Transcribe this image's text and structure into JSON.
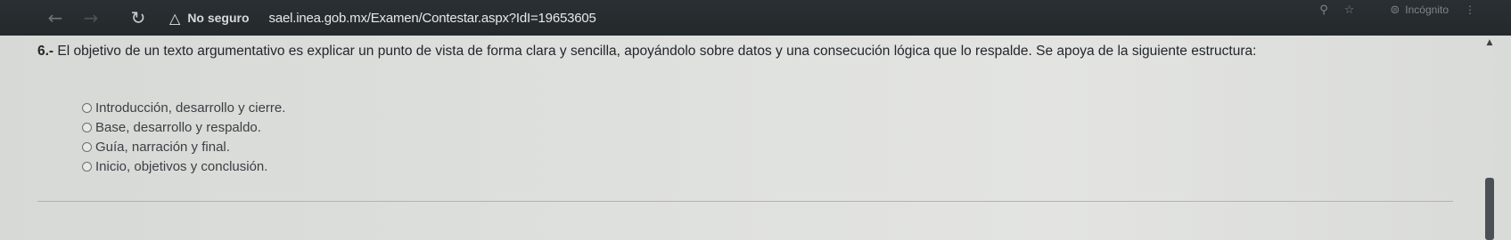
{
  "browser": {
    "security_label": "No seguro",
    "url": "sael.inea.gob.mx/Examen/Contestar.aspx?IdI=19653605",
    "incognito_label": "Incógnito",
    "icons": {
      "back": "arrow-left-icon",
      "forward": "arrow-right-icon",
      "reload": "reload-icon",
      "warning": "warning-icon",
      "zoom": "magnifier-icon",
      "bookmark": "star-icon",
      "incognito": "incognito-icon",
      "menu": "kebab-menu-icon"
    }
  },
  "question": {
    "number": "6.-",
    "text": "El objetivo de un texto argumentativo es explicar un punto de vista de forma clara y sencilla, apoyándolo sobre datos y una consecución lógica que lo respalde. Se apoya de la siguiente estructura:"
  },
  "options": [
    {
      "label": "Introducción, desarrollo y cierre."
    },
    {
      "label": "Base, desarrollo y respaldo."
    },
    {
      "label": "Guía, narración y final."
    },
    {
      "label": "Inicio, objetivos y conclusión."
    }
  ]
}
